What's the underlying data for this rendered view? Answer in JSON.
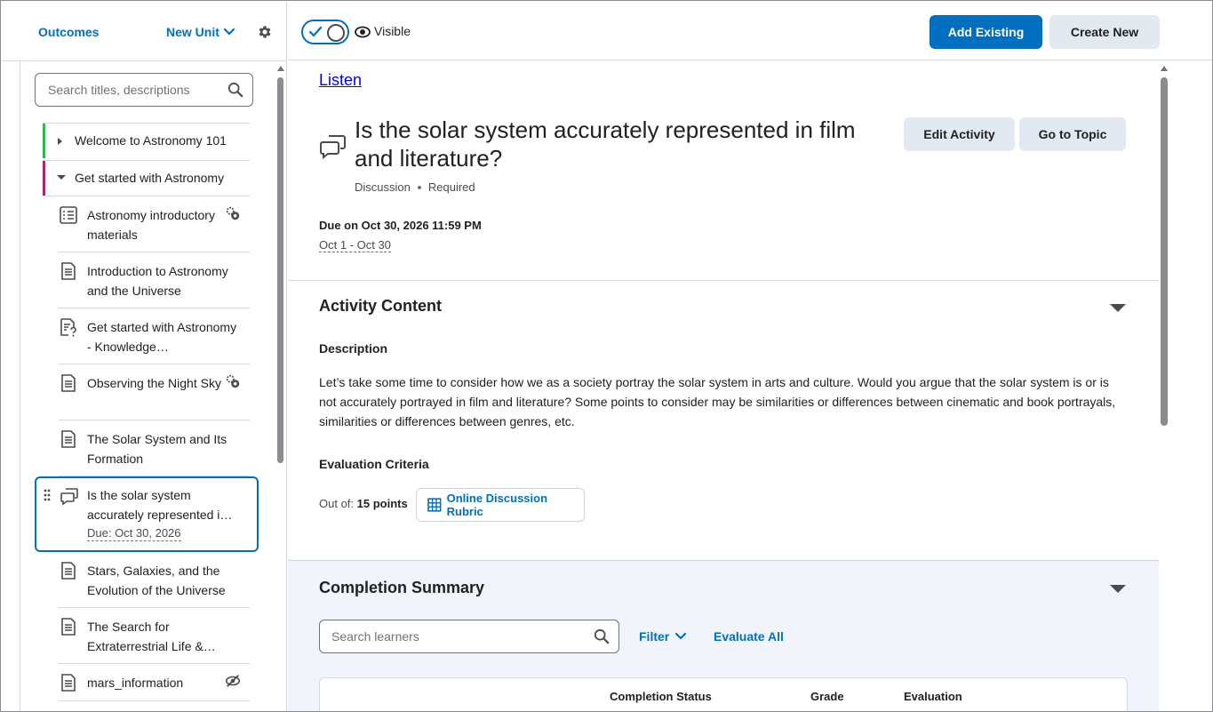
{
  "sidebar": {
    "outcomes_label": "Outcomes",
    "new_unit_label": "New Unit",
    "search_placeholder": "Search titles, descriptions",
    "units": [
      {
        "label": "Welcome to Astronomy 101",
        "color": "#2eb84c",
        "expanded": false
      },
      {
        "label": "Get started with Astronomy",
        "color": "#b1216f",
        "expanded": true
      }
    ],
    "items": [
      {
        "label": "Astronomy introductory materials",
        "icon": "checklist-icon",
        "badge": "release-conditions-icon"
      },
      {
        "label": "Introduction to Astronomy and the Universe",
        "icon": "document-icon"
      },
      {
        "label": "Get started with Astronomy - Knowledge…",
        "icon": "quiz-icon"
      },
      {
        "label": "Observing the Night Sky",
        "icon": "document-icon",
        "badge": "release-conditions-icon"
      },
      {
        "label": "The Solar System and Its Formation",
        "icon": "document-icon"
      },
      {
        "label": "Is the solar system accurately represented i…",
        "icon": "discussion-icon",
        "due": "Due: Oct 30, 2026",
        "selected": true
      },
      {
        "label": "Stars, Galaxies, and the Evolution of the Universe",
        "icon": "document-icon"
      },
      {
        "label": "The Search for Extraterrestrial Life &…",
        "icon": "document-icon"
      },
      {
        "label": "mars_information",
        "icon": "document-icon",
        "badge": "hidden-icon"
      }
    ]
  },
  "topbar": {
    "visibility_label": "Visible",
    "visibility_on": true,
    "add_existing_label": "Add Existing",
    "create_new_label": "Create New"
  },
  "main": {
    "listen_label": "Listen",
    "title": "Is the solar system accurately represented in film and literature?",
    "type": "Discussion",
    "requirement": "Required",
    "edit_activity_label": "Edit Activity",
    "go_to_topic_label": "Go to Topic",
    "due": "Due on Oct 30, 2026 11:59 PM",
    "date_range": "Oct 1 - Oct 30",
    "activity_content_title": "Activity Content",
    "description_label": "Description",
    "description_text": "Let’s take some time to consider how we as a society portray the solar system in arts and culture. Would you argue that the solar system is or is not accurately portrayed in film and literature? Some points to consider may be similarities or differences between cinematic and book portrayals, similarities or differences between genres, etc.",
    "evaluation_label": "Evaluation Criteria",
    "out_of_label": "Out of:",
    "out_of_value": "15 points",
    "rubric_label": "Online Discussion Rubric",
    "completion_title": "Completion Summary",
    "learner_search_placeholder": "Search learners",
    "filter_label": "Filter",
    "evaluate_all_label": "Evaluate All",
    "table_headers": [
      "Completion Status",
      "Grade",
      "Evaluation"
    ]
  },
  "colors": {
    "accent": "#006fbf",
    "unit_welcome": "#2eb84c",
    "unit_getstarted": "#b1216f"
  }
}
